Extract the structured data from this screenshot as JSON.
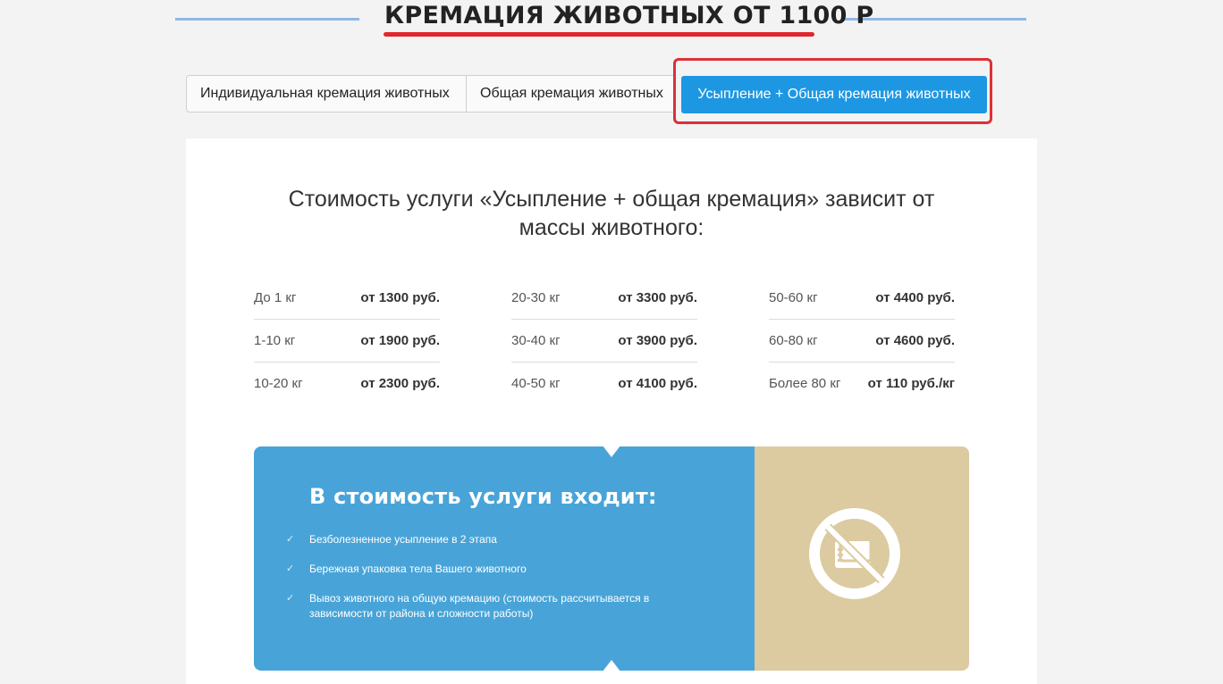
{
  "header": {
    "title": "КРЕМАЦИЯ ЖИВОТНЫХ ОТ 1100 Р"
  },
  "tabs": [
    {
      "label": "Индивидуальная кремация животных",
      "active": false
    },
    {
      "label": "Общая кремация животных",
      "active": false
    },
    {
      "label": "Усыпление + Общая кремация животных",
      "active": true
    }
  ],
  "card": {
    "heading_line1": "Стоимость услуги «Усыпление + общая кремация» зависит от",
    "heading_line2": "массы животного:",
    "prices": [
      [
        {
          "weight": "До 1 кг",
          "price": "от 1300 руб."
        },
        {
          "weight": "1-10 кг",
          "price": "от 1900 руб."
        },
        {
          "weight": "10-20 кг",
          "price": "от 2300 руб."
        }
      ],
      [
        {
          "weight": "20-30 кг",
          "price": "от 3300 руб."
        },
        {
          "weight": "30-40 кг",
          "price": "от 3900 руб."
        },
        {
          "weight": "40-50 кг",
          "price": "от 4100 руб."
        }
      ],
      [
        {
          "weight": "50-60 кг",
          "price": "от 4400 руб."
        },
        {
          "weight": "60-80 кг",
          "price": "от 4600 руб."
        },
        {
          "weight": "Более 80 кг",
          "price": "от 110 руб./кг"
        }
      ]
    ]
  },
  "includes": {
    "title": "В стоимость услуги входит:",
    "items": [
      "Безболезненное усыпление в 2 этапа",
      "Бережная упаковка тела Вашего животного",
      "Вывоз животного на общую кремацию (стоимость рассчитывается в зависимости от района и сложности работы)"
    ],
    "icon": "no-money-icon"
  },
  "colors": {
    "accent_red": "#e0262d",
    "tab_active": "#1e97e3",
    "info_blue": "#48a4d8",
    "info_tan": "#dccaa0"
  }
}
